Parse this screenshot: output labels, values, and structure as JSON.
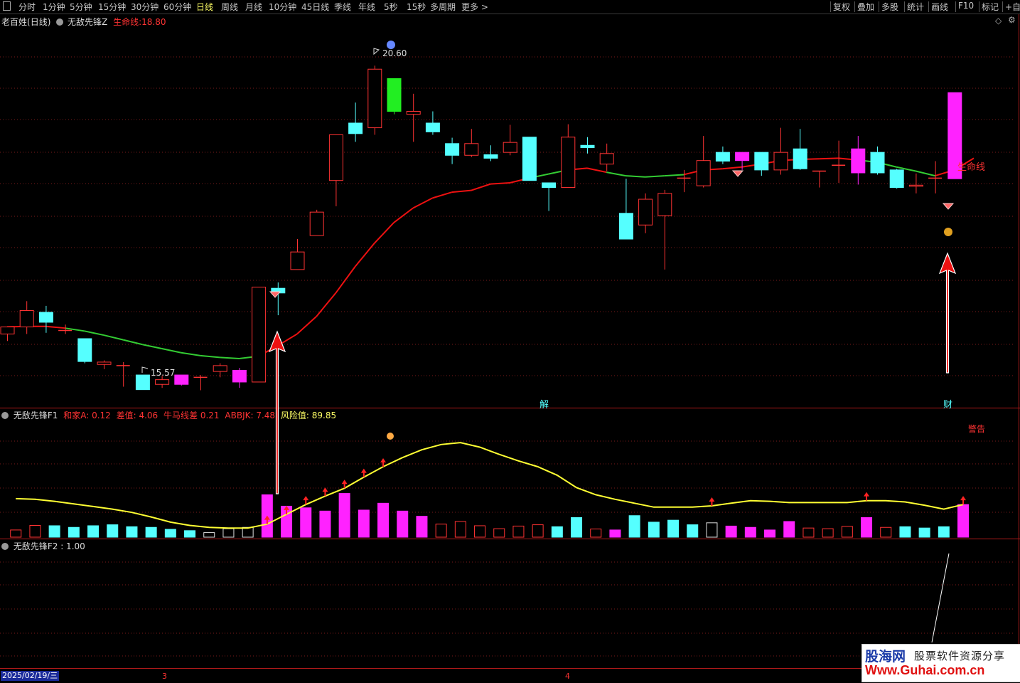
{
  "toolbar": {
    "periods": [
      "分时",
      "1分钟",
      "5分钟",
      "15分钟",
      "30分钟",
      "60分钟",
      "日线",
      "周线",
      "月线",
      "10分钟",
      "45日线",
      "季线",
      "年线",
      "5秒",
      "15秒",
      "多周期",
      "更多 >"
    ],
    "active": "日线",
    "right_buttons": [
      "复权",
      "叠加",
      "多股",
      "统计",
      "画线",
      "F10",
      "标记",
      "+自"
    ]
  },
  "main_panel": {
    "stock_name": "老百姓",
    "period_label": "(日线)",
    "indicator_name": "无敌先锋Z",
    "lifeline_label": "生命线:",
    "lifeline_value": "18.80",
    "lifeline_tag": "生命线",
    "high_label": "20.60",
    "low_label": "15.57",
    "marker_jie": "解",
    "marker_cai": "财"
  },
  "panel_f1": {
    "name": "无敌先锋F1",
    "items": [
      {
        "label": "和家A:",
        "value": "0.12",
        "color": "#ff3333"
      },
      {
        "label": "差值:",
        "value": "4.06",
        "color": "#ff3333"
      },
      {
        "label": "牛马线差",
        "value": "0.21",
        "color": "#ff3333"
      },
      {
        "label": "ABBJK:",
        "value": "7.48",
        "color": "#ff3333"
      },
      {
        "label": "风险值:",
        "value": "89.85",
        "color": "#ffff66"
      }
    ],
    "warning": "警告"
  },
  "panel_f2": {
    "name": "无敌先锋F2",
    "value": ": 1.00"
  },
  "date_axis": {
    "date": "2025/02/19/三",
    "labels": [
      "3",
      "4"
    ]
  },
  "watermark": {
    "brand": "股海网",
    "slogan": "股票软件资源分享",
    "url": "Www.Guhai.com.cn"
  },
  "colors": {
    "up": "#ff3333",
    "down": "#55ffff",
    "limit_up": "#ff22ff",
    "limit_down": "#22ee22",
    "lifeline_up": "#ee1111",
    "lifeline_down": "#33cc33",
    "risk_line": "#ffff33"
  },
  "chart_data": {
    "type": "candlestick",
    "price_range": [
      14.9,
      21.3
    ],
    "candles": [
      {
        "o": 16.0,
        "h": 16.12,
        "l": 15.88,
        "c": 16.12,
        "s": "up"
      },
      {
        "o": 16.12,
        "h": 16.56,
        "l": 16.0,
        "c": 16.4,
        "s": "up"
      },
      {
        "o": 16.37,
        "h": 16.48,
        "l": 16.02,
        "c": 16.2,
        "s": "down"
      },
      {
        "o": 16.06,
        "h": 16.16,
        "l": 16.0,
        "c": 16.06,
        "s": "flat"
      },
      {
        "o": 15.92,
        "h": 15.92,
        "l": 15.5,
        "c": 15.53,
        "s": "down"
      },
      {
        "o": 15.48,
        "h": 15.55,
        "l": 15.4,
        "c": 15.52,
        "s": "up"
      },
      {
        "o": 15.46,
        "h": 15.52,
        "l": 15.1,
        "c": 15.46,
        "s": "flat"
      },
      {
        "o": 15.3,
        "h": 15.3,
        "l": 15.05,
        "c": 15.05,
        "s": "down"
      },
      {
        "o": 15.14,
        "h": 15.28,
        "l": 15.08,
        "c": 15.22,
        "s": "up"
      },
      {
        "o": 15.14,
        "h": 15.3,
        "l": 15.12,
        "c": 15.3,
        "s": "limit_up"
      },
      {
        "o": 15.26,
        "h": 15.3,
        "l": 15.04,
        "c": 15.26,
        "s": "flat"
      },
      {
        "o": 15.36,
        "h": 15.5,
        "l": 15.26,
        "c": 15.46,
        "s": "up"
      },
      {
        "o": 15.18,
        "h": 15.42,
        "l": 15.08,
        "c": 15.38,
        "s": "limit_up"
      },
      {
        "o": 15.18,
        "h": 16.8,
        "l": 15.18,
        "c": 16.8,
        "s": "up"
      },
      {
        "o": 16.78,
        "h": 16.88,
        "l": 16.32,
        "c": 16.7,
        "s": "down"
      },
      {
        "o": 17.1,
        "h": 17.62,
        "l": 17.1,
        "c": 17.4,
        "s": "up"
      },
      {
        "o": 17.68,
        "h": 18.12,
        "l": 17.68,
        "c": 18.08,
        "s": "up"
      },
      {
        "o": 18.62,
        "h": 19.38,
        "l": 18.18,
        "c": 19.4,
        "s": "up"
      },
      {
        "o": 19.6,
        "h": 19.95,
        "l": 19.28,
        "c": 19.42,
        "s": "down"
      },
      {
        "o": 19.52,
        "h": 20.58,
        "l": 19.4,
        "c": 20.52,
        "s": "up"
      },
      {
        "o": 20.36,
        "h": 20.36,
        "l": 19.75,
        "c": 19.8,
        "s": "limit_down"
      },
      {
        "o": 19.8,
        "h": 20.1,
        "l": 19.28,
        "c": 19.75,
        "s": "up"
      },
      {
        "o": 19.6,
        "h": 19.8,
        "l": 19.4,
        "c": 19.45,
        "s": "down"
      },
      {
        "o": 19.25,
        "h": 19.35,
        "l": 18.9,
        "c": 19.05,
        "s": "down"
      },
      {
        "o": 19.05,
        "h": 19.5,
        "l": 19.02,
        "c": 19.25,
        "s": "up"
      },
      {
        "o": 19.06,
        "h": 19.22,
        "l": 18.95,
        "c": 19.0,
        "s": "down"
      },
      {
        "o": 19.1,
        "h": 19.57,
        "l": 19.05,
        "c": 19.27,
        "s": "up"
      },
      {
        "o": 19.36,
        "h": 19.36,
        "l": 18.62,
        "c": 18.62,
        "s": "down"
      },
      {
        "o": 18.58,
        "h": 18.58,
        "l": 18.1,
        "c": 18.5,
        "s": "down"
      },
      {
        "o": 18.5,
        "h": 19.58,
        "l": 18.5,
        "c": 19.36,
        "s": "up"
      },
      {
        "o": 19.22,
        "h": 19.36,
        "l": 19.08,
        "c": 19.18,
        "s": "down"
      },
      {
        "o": 18.9,
        "h": 19.25,
        "l": 18.78,
        "c": 19.08,
        "s": "up"
      },
      {
        "o": 18.06,
        "h": 18.65,
        "l": 17.62,
        "c": 17.62,
        "s": "down"
      },
      {
        "o": 17.86,
        "h": 18.4,
        "l": 17.72,
        "c": 18.3,
        "s": "up"
      },
      {
        "o": 18.02,
        "h": 18.46,
        "l": 17.1,
        "c": 18.4,
        "s": "up"
      },
      {
        "o": 18.66,
        "h": 18.8,
        "l": 18.42,
        "c": 18.66,
        "s": "flat"
      },
      {
        "o": 18.53,
        "h": 19.38,
        "l": 18.5,
        "c": 18.96,
        "s": "up"
      },
      {
        "o": 19.1,
        "h": 19.2,
        "l": 18.9,
        "c": 18.95,
        "s": "down"
      },
      {
        "o": 18.96,
        "h": 19.1,
        "l": 18.8,
        "c": 19.1,
        "s": "limit_up"
      },
      {
        "o": 19.1,
        "h": 19.1,
        "l": 18.7,
        "c": 18.8,
        "s": "down"
      },
      {
        "o": 18.8,
        "h": 19.52,
        "l": 18.72,
        "c": 19.1,
        "s": "up"
      },
      {
        "o": 19.16,
        "h": 19.5,
        "l": 18.8,
        "c": 18.82,
        "s": "down"
      },
      {
        "o": 18.78,
        "h": 18.78,
        "l": 18.5,
        "c": 18.78,
        "s": "flat"
      },
      {
        "o": 18.88,
        "h": 19.3,
        "l": 18.58,
        "c": 18.88,
        "s": "flat"
      },
      {
        "o": 18.75,
        "h": 19.38,
        "l": 18.55,
        "c": 19.16,
        "s": "limit_up"
      },
      {
        "o": 19.1,
        "h": 19.2,
        "l": 18.72,
        "c": 18.75,
        "s": "down"
      },
      {
        "o": 18.8,
        "h": 18.82,
        "l": 18.48,
        "c": 18.5,
        "s": "down"
      },
      {
        "o": 18.54,
        "h": 18.74,
        "l": 18.4,
        "c": 18.54,
        "s": "up"
      },
      {
        "o": 18.66,
        "h": 18.95,
        "l": 18.4,
        "c": 18.66,
        "s": "flat"
      },
      {
        "o": 18.65,
        "h": 20.12,
        "l": 18.65,
        "c": 20.12,
        "s": "limit_up"
      }
    ],
    "lifeline": [
      16.12,
      16.13,
      16.13,
      16.1,
      16.05,
      15.98,
      15.9,
      15.82,
      15.75,
      15.68,
      15.63,
      15.6,
      15.58,
      15.62,
      15.8,
      16.0,
      16.3,
      16.7,
      17.15,
      17.55,
      17.9,
      18.15,
      18.32,
      18.42,
      18.45,
      18.56,
      18.58,
      18.66,
      18.73,
      18.8,
      18.83,
      18.76,
      18.7,
      18.68,
      18.7,
      18.72,
      18.8,
      18.82,
      18.85,
      18.9,
      18.96,
      18.98,
      18.99,
      19.0,
      18.97,
      18.93,
      18.85,
      18.78,
      18.7,
      18.8,
      19.0
    ],
    "lifeline_down_segments": [
      [
        3,
        13
      ],
      [
        27,
        29
      ],
      [
        31,
        35
      ],
      [
        44,
        48
      ]
    ],
    "f1_bars": [
      {
        "v": 0.22,
        "t": "h"
      },
      {
        "v": 0.36,
        "t": "h"
      },
      {
        "v": 0.35,
        "t": "c"
      },
      {
        "v": 0.3,
        "t": "c"
      },
      {
        "v": 0.35,
        "t": "c"
      },
      {
        "v": 0.38,
        "t": "c"
      },
      {
        "v": 0.32,
        "t": "c"
      },
      {
        "v": 0.3,
        "t": "c"
      },
      {
        "v": 0.24,
        "t": "c"
      },
      {
        "v": 0.2,
        "t": "c"
      },
      {
        "v": 0.14,
        "t": "hw"
      },
      {
        "v": 0.26,
        "t": "hw"
      },
      {
        "v": 0.3,
        "t": "hw"
      },
      {
        "v": 1.3,
        "t": "m"
      },
      {
        "v": 0.95,
        "t": "m"
      },
      {
        "v": 0.9,
        "t": "m"
      },
      {
        "v": 0.8,
        "t": "m"
      },
      {
        "v": 1.34,
        "t": "m"
      },
      {
        "v": 0.83,
        "t": "m"
      },
      {
        "v": 1.04,
        "t": "m"
      },
      {
        "v": 0.8,
        "t": "m"
      },
      {
        "v": 0.64,
        "t": "m"
      },
      {
        "v": 0.4,
        "t": "h"
      },
      {
        "v": 0.48,
        "t": "h"
      },
      {
        "v": 0.35,
        "t": "h"
      },
      {
        "v": 0.26,
        "t": "h"
      },
      {
        "v": 0.34,
        "t": "h"
      },
      {
        "v": 0.38,
        "t": "h"
      },
      {
        "v": 0.32,
        "t": "c"
      },
      {
        "v": 0.6,
        "t": "c"
      },
      {
        "v": 0.25,
        "t": "h"
      },
      {
        "v": 0.22,
        "t": "m"
      },
      {
        "v": 0.66,
        "t": "c"
      },
      {
        "v": 0.46,
        "t": "c"
      },
      {
        "v": 0.52,
        "t": "c"
      },
      {
        "v": 0.38,
        "t": "c"
      },
      {
        "v": 0.44,
        "t": "hw"
      },
      {
        "v": 0.34,
        "t": "m"
      },
      {
        "v": 0.3,
        "t": "m"
      },
      {
        "v": 0.22,
        "t": "m"
      },
      {
        "v": 0.48,
        "t": "m"
      },
      {
        "v": 0.28,
        "t": "h"
      },
      {
        "v": 0.26,
        "t": "h"
      },
      {
        "v": 0.33,
        "t": "h"
      },
      {
        "v": 0.6,
        "t": "m"
      },
      {
        "v": 0.3,
        "t": "h"
      },
      {
        "v": 0.32,
        "t": "c"
      },
      {
        "v": 0.28,
        "t": "c"
      },
      {
        "v": 0.32,
        "t": "c"
      },
      {
        "v": 1.0,
        "t": "m"
      }
    ],
    "f1_line": [
      1.18,
      1.16,
      1.1,
      1.02,
      0.94,
      0.86,
      0.76,
      0.62,
      0.46,
      0.36,
      0.3,
      0.28,
      0.28,
      0.4,
      0.7,
      1.0,
      1.26,
      1.5,
      1.84,
      2.16,
      2.44,
      2.68,
      2.84,
      2.9,
      2.76,
      2.54,
      2.34,
      2.16,
      1.9,
      1.52,
      1.3,
      1.16,
      1.04,
      0.92,
      0.92,
      0.92,
      0.96,
      1.04,
      1.12,
      1.1,
      1.06,
      1.06,
      1.06,
      1.06,
      1.12,
      1.12,
      1.08,
      0.98,
      0.86,
      1.0
    ],
    "f1_arrows": [
      13,
      14,
      15,
      16,
      17,
      18,
      19,
      36,
      44,
      49
    ],
    "f1_range": [
      0,
      3.6
    ],
    "f2_line": [
      [
        1311,
        903
      ],
      [
        1335,
        778
      ]
    ]
  }
}
